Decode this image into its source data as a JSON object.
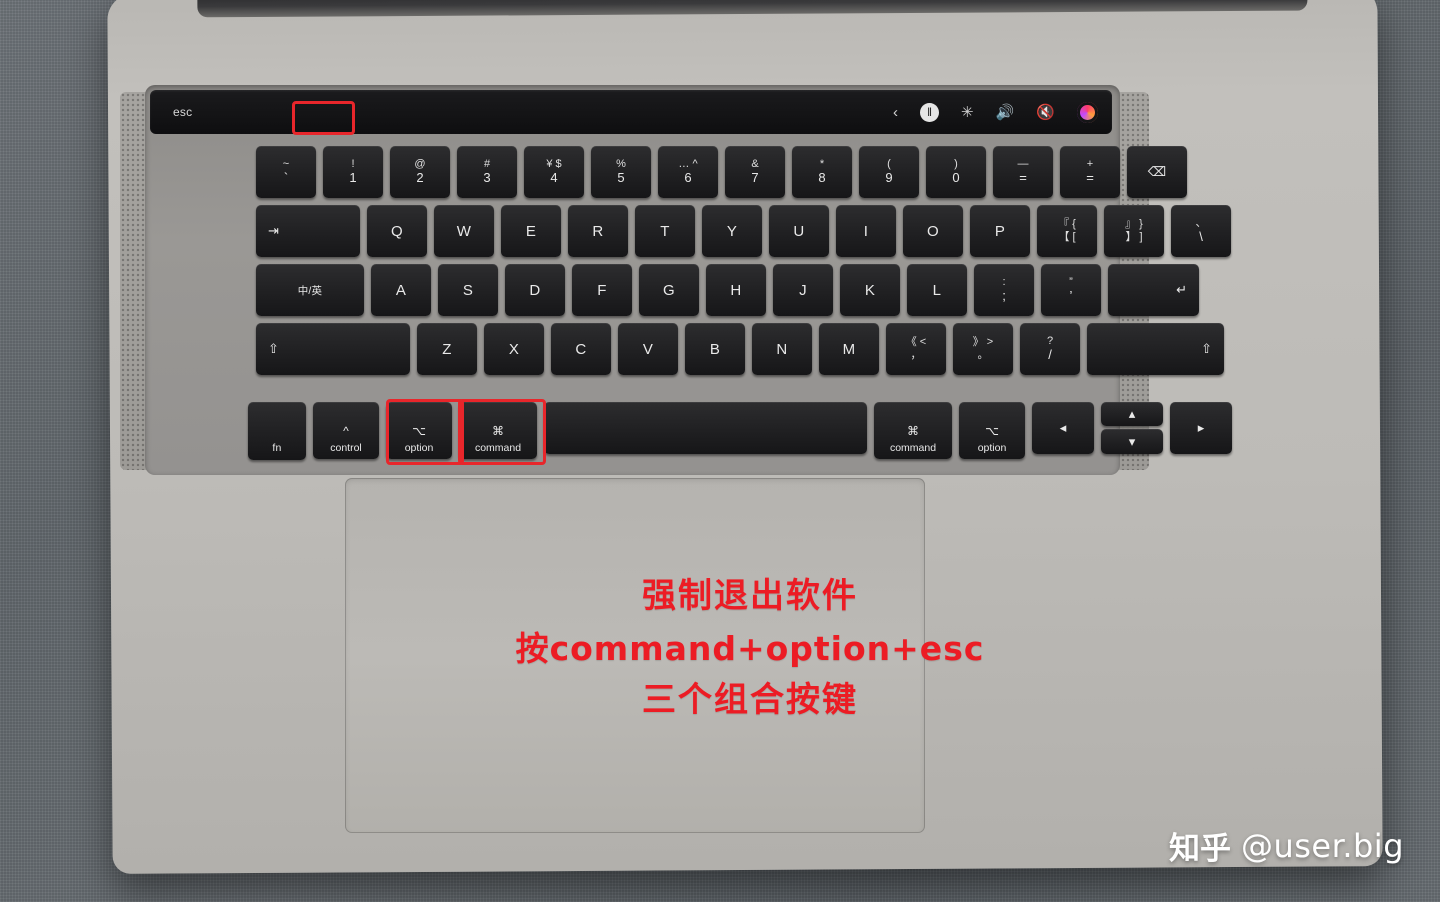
{
  "scene": {
    "description": "MacBook Pro keyboard photo with red annotation",
    "accent_color": "#e8262b",
    "annotation_color": "#ec1c24"
  },
  "touchbar": {
    "esc_label": "esc",
    "icons": [
      {
        "name": "back-chevron-icon",
        "glyph": "‹"
      },
      {
        "name": "play-pause-icon",
        "glyph": "‖"
      },
      {
        "name": "brightness-icon",
        "glyph": "✳"
      },
      {
        "name": "volume-icon",
        "glyph": "🔊"
      },
      {
        "name": "mute-icon",
        "glyph": "🔇"
      },
      {
        "name": "siri-icon",
        "glyph": ""
      }
    ]
  },
  "keyboard": {
    "row_numbers": [
      {
        "top": "~",
        "bottom": "`"
      },
      {
        "top": "!",
        "bottom": "1"
      },
      {
        "top": "@",
        "bottom": "2"
      },
      {
        "top": "#",
        "bottom": "3"
      },
      {
        "top": "¥ $",
        "bottom": "4"
      },
      {
        "top": "%",
        "bottom": "5"
      },
      {
        "top": "… ^",
        "bottom": "6"
      },
      {
        "top": "&",
        "bottom": "7"
      },
      {
        "top": "*",
        "bottom": "8"
      },
      {
        "top": "(",
        "bottom": "9"
      },
      {
        "top": ")",
        "bottom": "0"
      },
      {
        "top": "—",
        "bottom": "="
      },
      {
        "top": "+",
        "bottom": "="
      }
    ],
    "delete_key": "⌫",
    "row_q": {
      "tab": "⇥",
      "keys": [
        "Q",
        "W",
        "E",
        "R",
        "T",
        "Y",
        "U",
        "I",
        "O",
        "P"
      ],
      "bracket_left": {
        "top": "『 {",
        "bottom": "【 ["
      },
      "bracket_right": {
        "top": "』 }",
        "bottom": "】 ]"
      },
      "backslash": {
        "top": "、",
        "bottom": "\\"
      }
    },
    "row_a": {
      "caps": "中/英",
      "keys": [
        "A",
        "S",
        "D",
        "F",
        "G",
        "H",
        "J",
        "K",
        "L"
      ],
      "semicolon": {
        "top": ":",
        "bottom": ";"
      },
      "quote": {
        "top": "”",
        "bottom": "’"
      },
      "return": "↵"
    },
    "row_z": {
      "shift_left": "⇧",
      "keys": [
        "Z",
        "X",
        "C",
        "V",
        "B",
        "N",
        "M"
      ],
      "comma": {
        "top": "《 <",
        "bottom": "，"
      },
      "period": {
        "top": "》 >",
        "bottom": "。"
      },
      "slash": {
        "top": "?",
        "bottom": "/"
      },
      "shift_right": "⇧"
    },
    "row_mod": {
      "fn": "fn",
      "control": {
        "glyph": "^",
        "label": "control"
      },
      "option_left": {
        "glyph": "⌥",
        "label": "option"
      },
      "command_left": {
        "glyph": "⌘",
        "label": "command"
      },
      "space": "",
      "command_right": {
        "glyph": "⌘",
        "label": "command"
      },
      "option_right": {
        "glyph": "⌥",
        "label": "option"
      },
      "arrow_left": "◂",
      "arrow_up": "▴",
      "arrow_down": "▾",
      "arrow_right": "▸"
    }
  },
  "highlights": [
    {
      "name": "highlight-esc",
      "key": "esc"
    },
    {
      "name": "highlight-option",
      "key": "option"
    },
    {
      "name": "highlight-command",
      "key": "command"
    }
  ],
  "annotation": {
    "line1": "强制退出软件",
    "line2": "按command+option+esc",
    "line3": "三个组合按键"
  },
  "watermark": {
    "logo": "知乎",
    "user": "@user.big"
  }
}
